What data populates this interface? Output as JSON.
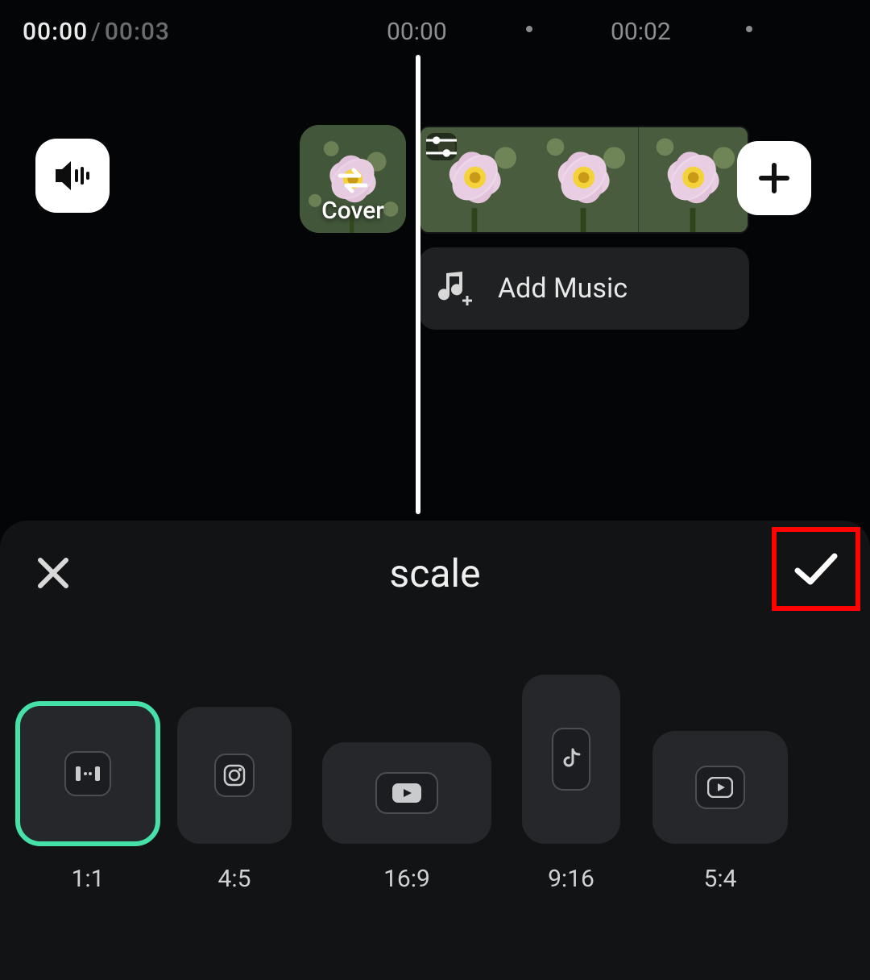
{
  "time": {
    "current": "00:00",
    "duration": "00:03",
    "ticks": [
      "00:00",
      "00:02"
    ]
  },
  "timeline": {
    "cover_label": "Cover",
    "add_music_label": "Add Music"
  },
  "panel": {
    "title": "scale",
    "ratios": [
      {
        "label": "1:1",
        "icon": "square-icon",
        "selected": true
      },
      {
        "label": "4:5",
        "icon": "instagram-icon",
        "selected": false
      },
      {
        "label": "16:9",
        "icon": "youtube-icon",
        "selected": false
      },
      {
        "label": "9:16",
        "icon": "tiktok-icon",
        "selected": false
      },
      {
        "label": "5:4",
        "icon": "play-icon",
        "selected": false
      }
    ]
  },
  "colors": {
    "accent_selected": "#46e0a9",
    "highlight_box": "#ff0202"
  }
}
